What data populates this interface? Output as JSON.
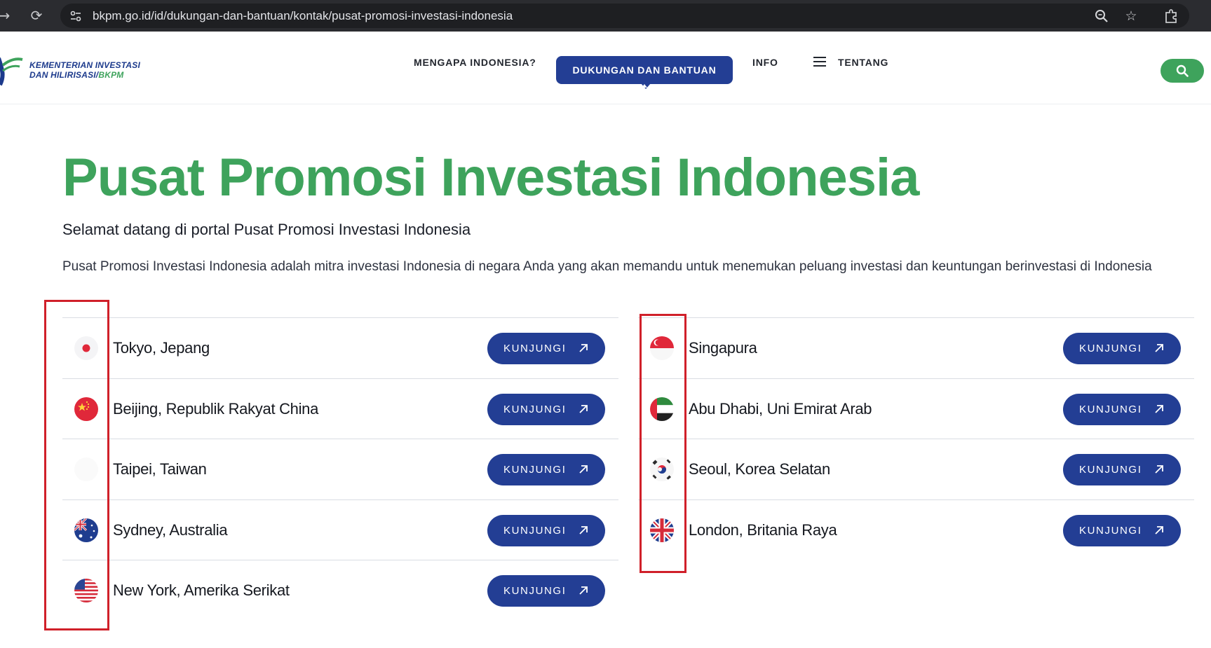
{
  "browser": {
    "url": "bkpm.go.id/id/dukungan-dan-bantuan/kontak/pusat-promosi-investasi-indonesia",
    "icons": [
      "forward-icon",
      "reload-icon",
      "site-settings-icon",
      "zoom-icon",
      "bookmark-star-icon",
      "extensions-icon"
    ]
  },
  "header": {
    "logo_line1": "KEMENTERIAN INVESTASI",
    "logo_line2_prefix": "DAN HILIRISASI/",
    "logo_line2_suffix": "BKPM",
    "nav": {
      "mengapa": "MENGAPA INDONESIA?",
      "dukungan": "DUKUNGAN DAN BANTUAN",
      "info": "INFO",
      "tentang": "TENTANG"
    },
    "colors": {
      "brand_blue": "#233e94",
      "brand_green": "#3ea35c"
    }
  },
  "main": {
    "title": "Pusat Promosi Investasi Indonesia",
    "welcome": "Selamat datang di portal Pusat Promosi Investasi Indonesia",
    "description": "Pusat Promosi Investasi Indonesia adalah mitra investasi Indonesia di negara Anda yang akan memandu untuk menemukan peluang investasi dan keuntungan berinvestasi di Indonesia",
    "button_label": "KUNJUNGI",
    "left_offices": [
      {
        "city": "Tokyo, Jepang",
        "flag": "japan-flag-icon"
      },
      {
        "city": "Beijing, Republik Rakyat China",
        "flag": "china-flag-icon"
      },
      {
        "city": "Taipei, Taiwan",
        "flag": "taiwan-flag-icon"
      },
      {
        "city": "Sydney, Australia",
        "flag": "australia-flag-icon"
      },
      {
        "city": "New York, Amerika Serikat",
        "flag": "usa-flag-icon"
      }
    ],
    "right_offices": [
      {
        "city": "Singapura",
        "flag": "singapore-flag-icon"
      },
      {
        "city": "Abu Dhabi, Uni Emirat Arab",
        "flag": "uae-flag-icon"
      },
      {
        "city": "Seoul, Korea Selatan",
        "flag": "korea-flag-icon"
      },
      {
        "city": "London, Britania Raya",
        "flag": "uk-flag-icon"
      }
    ]
  }
}
